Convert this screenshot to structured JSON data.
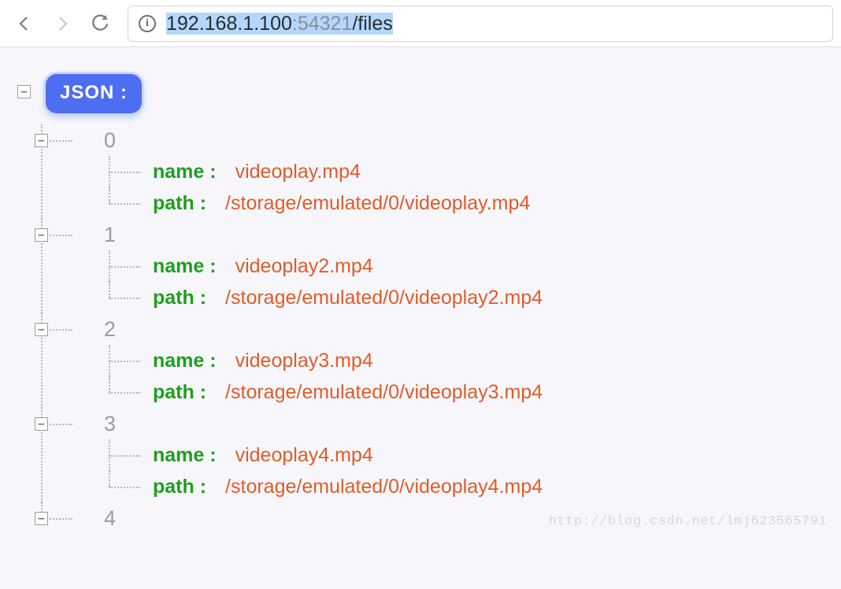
{
  "toolbar": {
    "url_host": "192.168.1.100",
    "url_port": ":54321",
    "url_path": "/files",
    "info_glyph": "i"
  },
  "json_label": "JSON :",
  "collapse_glyph": "−",
  "items": [
    {
      "index": "0",
      "name_key": "name :",
      "name_val": "videoplay.mp4",
      "path_key": "path :",
      "path_val": "/storage/emulated/0/videoplay.mp4"
    },
    {
      "index": "1",
      "name_key": "name :",
      "name_val": "videoplay2.mp4",
      "path_key": "path :",
      "path_val": "/storage/emulated/0/videoplay2.mp4"
    },
    {
      "index": "2",
      "name_key": "name :",
      "name_val": "videoplay3.mp4",
      "path_key": "path :",
      "path_val": "/storage/emulated/0/videoplay3.mp4"
    },
    {
      "index": "3",
      "name_key": "name :",
      "name_val": "videoplay4.mp4",
      "path_key": "path :",
      "path_val": "/storage/emulated/0/videoplay4.mp4"
    },
    {
      "index": "4"
    }
  ],
  "watermark": "http://blog.csdn.net/lmj623565791"
}
